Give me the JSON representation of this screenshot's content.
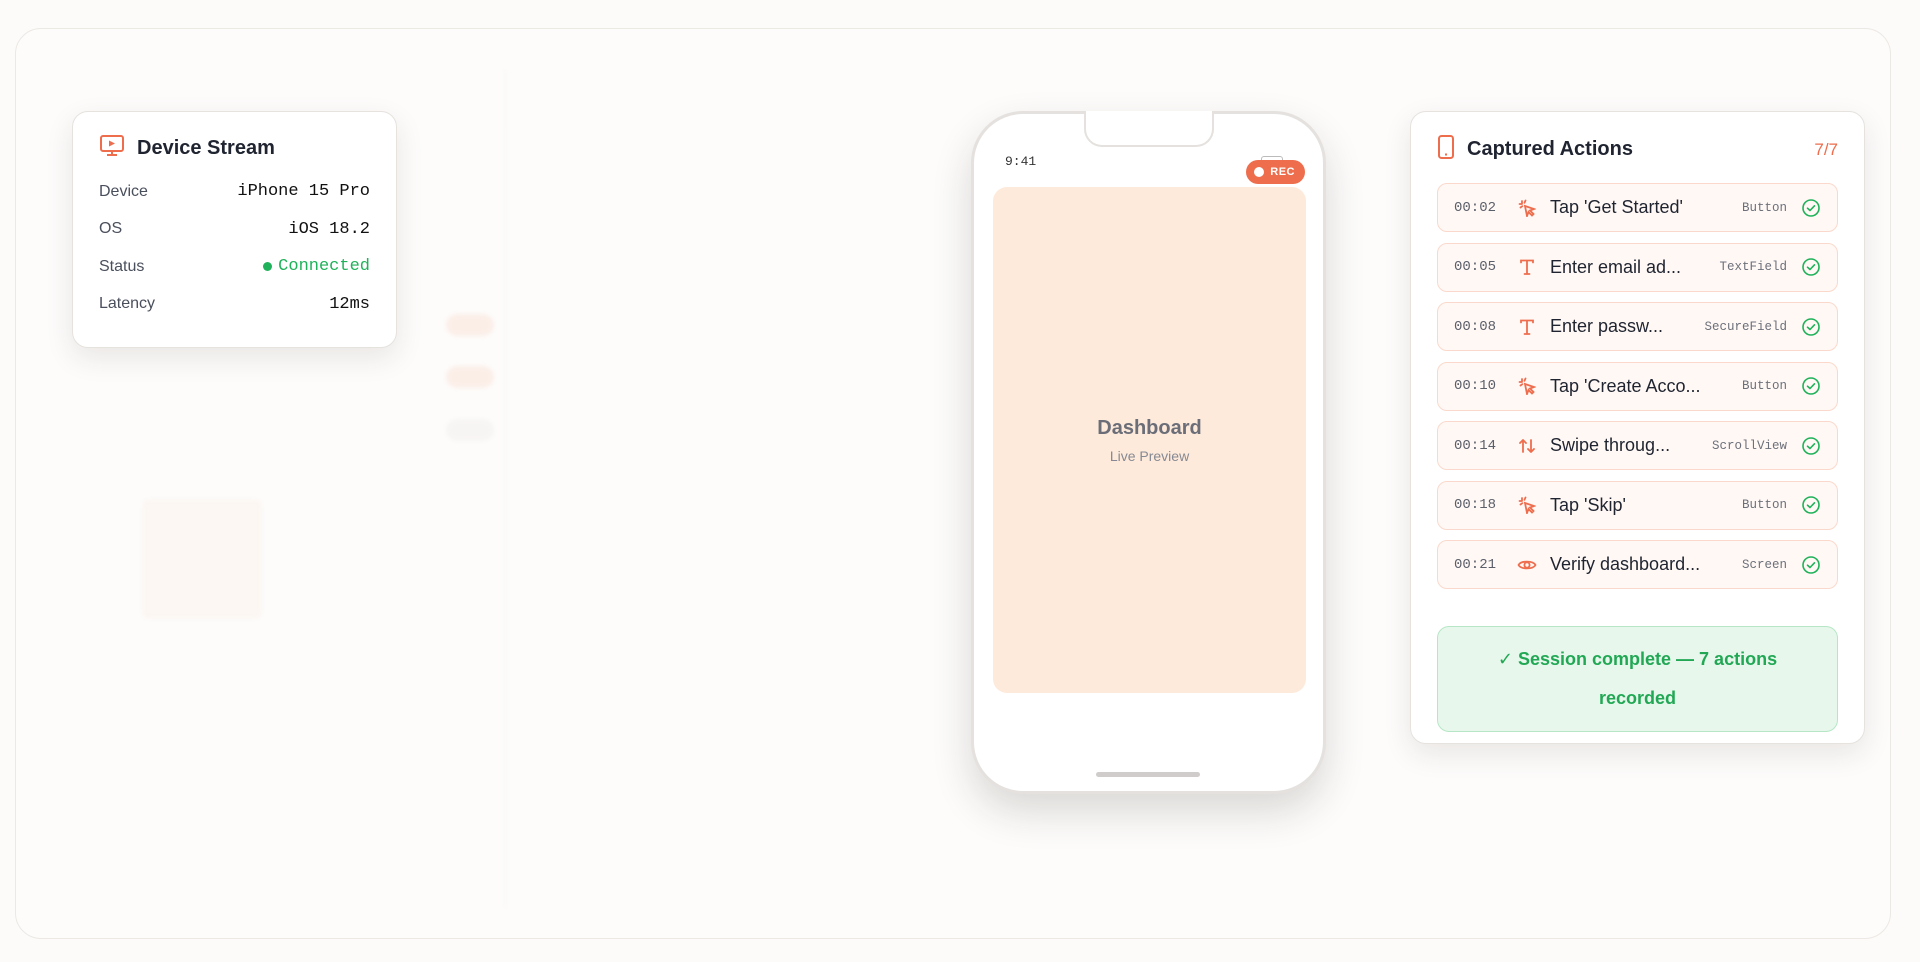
{
  "device_stream": {
    "title": "Device Stream",
    "icon": "monitor-play-icon",
    "rows": [
      {
        "label": "Device",
        "value": "iPhone 15 Pro"
      },
      {
        "label": "OS",
        "value": "iOS 18.2"
      },
      {
        "label": "Status",
        "value": "Connected"
      },
      {
        "label": "Latency",
        "value": "12ms"
      }
    ]
  },
  "phone": {
    "time": "9:41",
    "rec_label": "REC",
    "screen_title": "Dashboard",
    "screen_subtitle": "Live Preview"
  },
  "captured": {
    "title": "Captured Actions",
    "icon": "smartphone-icon",
    "count": "7/7",
    "actions": [
      {
        "time": "00:02",
        "icon": "tap-icon",
        "label": "Tap 'Get Started'",
        "type": "Button"
      },
      {
        "time": "00:05",
        "icon": "text-icon",
        "label": "Enter email ad...",
        "type": "TextField"
      },
      {
        "time": "00:08",
        "icon": "text-icon",
        "label": "Enter passw...",
        "type": "SecureField"
      },
      {
        "time": "00:10",
        "icon": "tap-icon",
        "label": "Tap 'Create Acco...",
        "type": "Button"
      },
      {
        "time": "00:14",
        "icon": "swipe-icon",
        "label": "Swipe throug...",
        "type": "ScrollView"
      },
      {
        "time": "00:18",
        "icon": "tap-icon",
        "label": "Tap 'Skip'",
        "type": "Button"
      },
      {
        "time": "00:21",
        "icon": "eye-icon",
        "label": "Verify dashboard...",
        "type": "Screen"
      }
    ],
    "complete_text": "✓ Session complete — 7 actions recorded"
  },
  "colors": {
    "accent": "#ee6d4d",
    "success": "#1fb25a"
  }
}
